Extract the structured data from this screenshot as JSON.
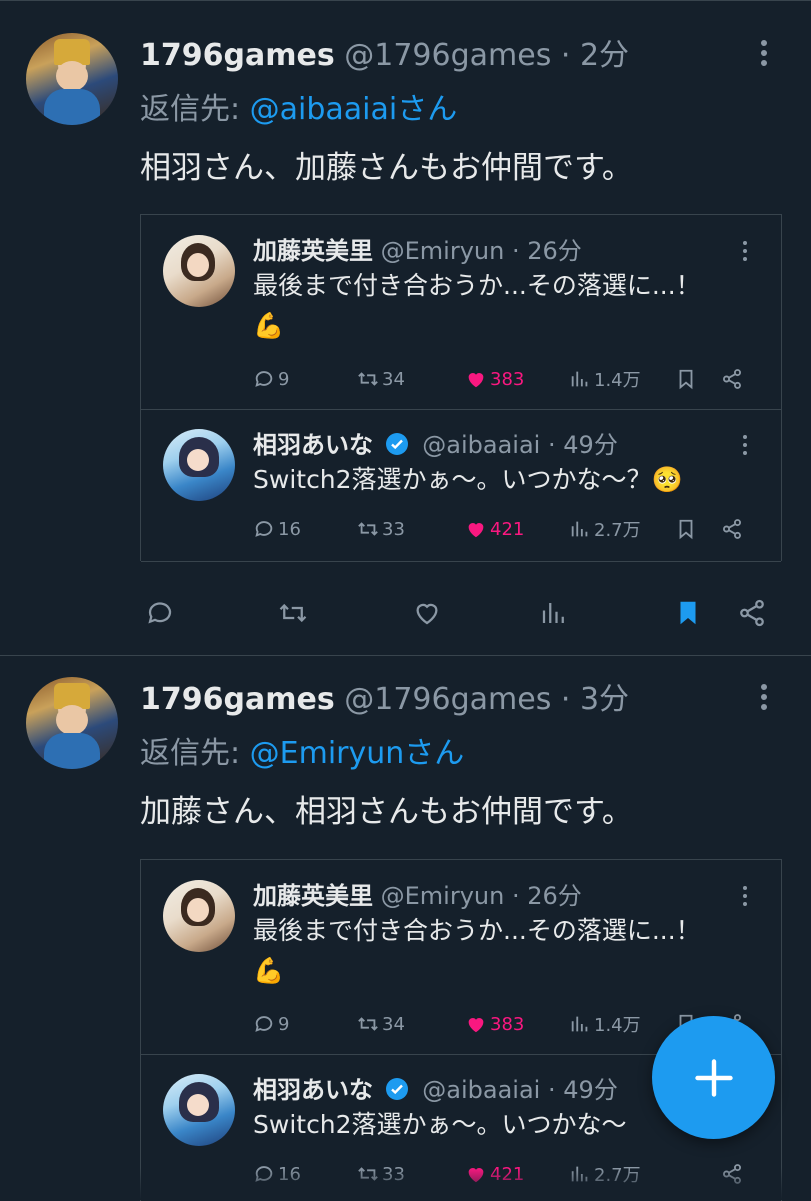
{
  "tweets": [
    {
      "display_name": "1796games",
      "handle": "@1796games",
      "sep": "·",
      "time": "2分",
      "reply_prefix": "返信先: ",
      "reply_mention": "@aibaaiaiさん",
      "text": "相羽さん、加藤さんもお仲間です。",
      "quoted": [
        {
          "display_name": "加藤英美里",
          "handle": "@Emiryun",
          "time": "26分",
          "text_line1": "最後まで付き合おうか...その落選に...！",
          "text_line2": "💪",
          "replies": "9",
          "retweets": "34",
          "likes": "383",
          "views": "1.4万"
        },
        {
          "display_name": "相羽あいな",
          "handle": "@aibaaiai",
          "time": "49分",
          "verified": true,
          "text_line1": "Switch2落選かぁ〜。いつかな〜？🥺",
          "replies": "16",
          "retweets": "33",
          "likes": "421",
          "views": "2.7万"
        }
      ],
      "bookmarked": true
    },
    {
      "display_name": "1796games",
      "handle": "@1796games",
      "sep": "·",
      "time": "3分",
      "reply_prefix": "返信先: ",
      "reply_mention": "@Emiryunさん",
      "text": "加藤さん、相羽さんもお仲間です。",
      "quoted": [
        {
          "display_name": "加藤英美里",
          "handle": "@Emiryun",
          "time": "26分",
          "text_line1": "最後まで付き合おうか...その落選に...！",
          "text_line2": "💪",
          "replies": "9",
          "retweets": "34",
          "likes": "383",
          "views": "1.4万"
        },
        {
          "display_name": "相羽あいな",
          "handle": "@aibaaiai",
          "time": "49分",
          "verified": true,
          "text_line1": "Switch2落選かぁ〜。いつかな〜",
          "replies": "16",
          "retweets": "33",
          "likes": "421",
          "views": "2.7万"
        }
      ]
    }
  ],
  "colors": {
    "background": "#15202b",
    "accent": "#1d9bf0",
    "like": "#f91880",
    "muted": "#8b98a5",
    "text": "#e7e9ea"
  },
  "icons": [
    "more-icon",
    "reply-icon",
    "retweet-icon",
    "like-icon",
    "views-icon",
    "bookmark-icon",
    "share-icon",
    "verified-icon",
    "compose-icon"
  ]
}
